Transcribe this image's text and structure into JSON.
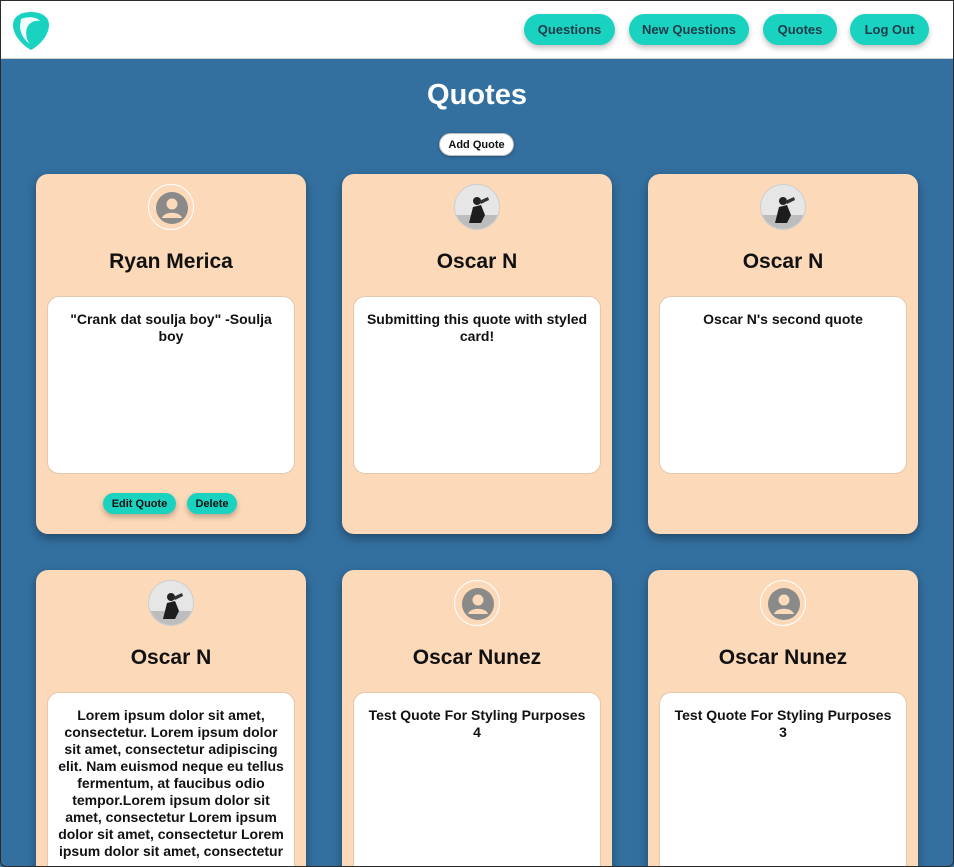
{
  "nav": {
    "questions": "Questions",
    "new_questions": "New Questions",
    "quotes": "Quotes",
    "logout": "Log Out"
  },
  "page": {
    "title": "Quotes",
    "add_quote": "Add Quote"
  },
  "cards": [
    {
      "name": "Ryan Merica",
      "quote": "\"Crank dat soulja boy\" -Soulja boy",
      "avatar": "default-avatar",
      "edit": "Edit Quote",
      "delete": "Delete"
    },
    {
      "name": "Oscar N",
      "quote": "Submitting this quote with styled card!",
      "avatar": "photo-avatar"
    },
    {
      "name": "Oscar N",
      "quote": "Oscar N's second quote",
      "avatar": "photo-avatar"
    },
    {
      "name": "Oscar N",
      "quote": "Lorem ipsum dolor sit amet, consectetur. Lorem ipsum dolor sit amet, consectetur adipiscing elit. Nam euismod neque eu tellus fermentum, at faucibus odio tempor.Lorem ipsum dolor sit amet, consectetur Lorem ipsum dolor sit amet, consectetur Lorem ipsum dolor sit amet, consectetur",
      "avatar": "photo-avatar"
    },
    {
      "name": "Oscar Nunez",
      "quote": "Test Quote For Styling Purposes 4",
      "avatar": "default-avatar"
    },
    {
      "name": "Oscar Nunez",
      "quote": "Test Quote For Styling Purposes 3",
      "avatar": "default-avatar"
    }
  ],
  "colors": {
    "accent": "#19d3c0",
    "background": "#3370a0",
    "card": "#fcd9b8"
  }
}
